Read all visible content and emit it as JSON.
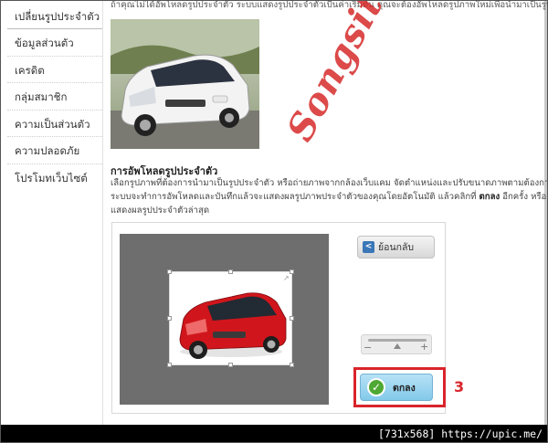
{
  "sidebar": {
    "items": [
      {
        "label": "เปลี่ยนรูปประจำตัว"
      },
      {
        "label": "ข้อมูลส่วนตัว"
      },
      {
        "label": "เครดิต"
      },
      {
        "label": "กลุ่มสมาชิก"
      },
      {
        "label": "ความเป็นส่วนตัว"
      },
      {
        "label": "ความปลอดภัย"
      },
      {
        "label": "โปรโมทเว็บไซต์"
      }
    ]
  },
  "main": {
    "intro": "ถ้าคุณไม่ได้อัพโหลดรูปประจำตัว ระบบแสดงรูปประจำตัวเป็นค่าเริ่มต้น คุณจะต้องอัพโหลดรูปภาพใหม่เพื่อนำมาเป็นรูปประจำตัว",
    "section_title": "การอัพโหลดรูปประจำตัว",
    "desc_line1": "เลือกรูปภาพที่ต้องการนำมาเป็นรูปประจำตัว หรือถ่ายภาพจากกล้องเว็บแคม จัดตำแหน่งและปรับขนาดภาพตามต้องการ แล้ว",
    "desc_line2_pre": "ระบบจะทำการอัพโหลดและบันทึกแล้วจะแสดงผลรูปภาพประจำตัวของคุณโดยอัตโนมัติ แล้วคลิกที่ ",
    "desc_line2_bold": "ตกลง",
    "desc_line2_post": " อีกครั้ง หรือคุณอาจ",
    "desc_line3": "แสดงผลรูปประจำตัวล่าสุด"
  },
  "editor": {
    "back_label": "ย้อนกลับ",
    "ok_label": "ตกลง",
    "zoom_minus": "−",
    "zoom_plus": "+",
    "crop_corner": "↗",
    "step_number": "3"
  },
  "watermark": {
    "text": "Songsith"
  },
  "footer": {
    "text": "[731x568] https://upic.me/"
  },
  "icons": {
    "back": "chevron-left-icon",
    "ok": "checkmark-icon"
  },
  "colors": {
    "highlight": "#d9252b",
    "ok_button": "#83c9ea",
    "check_green": "#4fa833",
    "crop_background": "#6e6e6e"
  }
}
